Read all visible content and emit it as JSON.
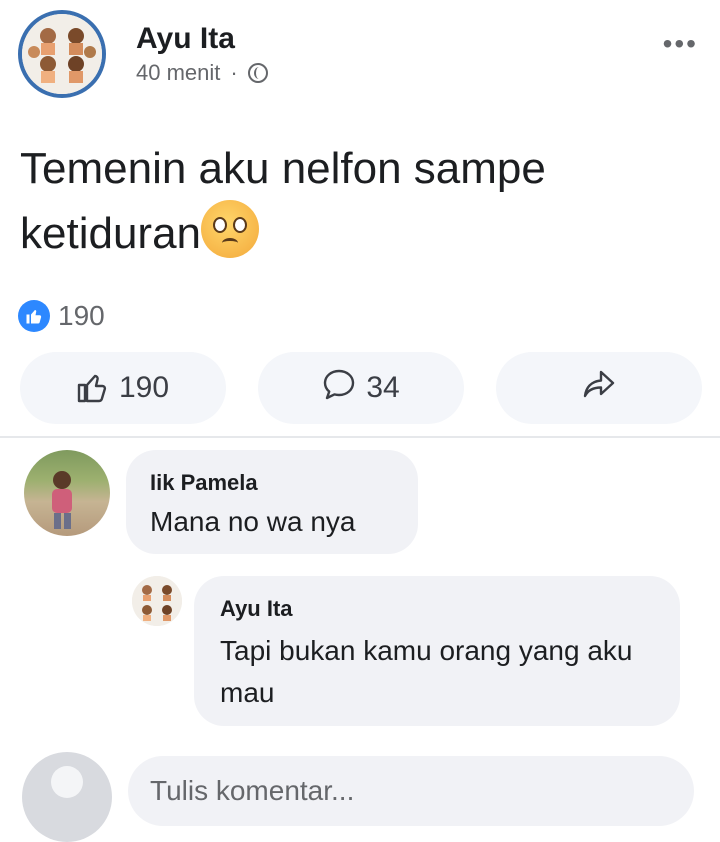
{
  "post": {
    "author": "Ayu Ita",
    "time": "40 menit",
    "separator": "·",
    "text": "Temenin aku nelfon sampe ketiduran",
    "reaction_count": "190"
  },
  "actions": {
    "like_count": "190",
    "comment_count": "34"
  },
  "comments": [
    {
      "author": "Iik Pamela",
      "text": "Mana no wa nya"
    },
    {
      "author": "Ayu Ita",
      "text": "Tapi bukan kamu orang yang aku mau"
    }
  ],
  "composer": {
    "placeholder": "Tulis komentar..."
  },
  "icons": {
    "more": "more-dots-icon",
    "privacy": "globe-icon",
    "like": "thumbs-up-icon",
    "comment": "comment-bubble-icon",
    "share": "share-arrow-icon",
    "emoji": "pleading-face-emoji"
  },
  "colors": {
    "like_blue": "#2d88ff",
    "avatar_ring": "#3a6fb0"
  }
}
